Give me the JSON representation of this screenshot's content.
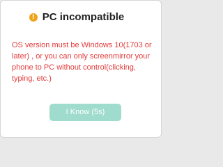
{
  "dialog": {
    "title": "PC incompatible",
    "icon": "warning-icon",
    "message": "OS version must be Windows 10(1703 or later) , or you can only screenmirror your phone to PC without control(clicking, typing, etc.)",
    "button_label": "I Know (5s)",
    "colors": {
      "warning": "#f0a21a",
      "message": "#e23b3b",
      "button": "#9fdccd"
    }
  }
}
